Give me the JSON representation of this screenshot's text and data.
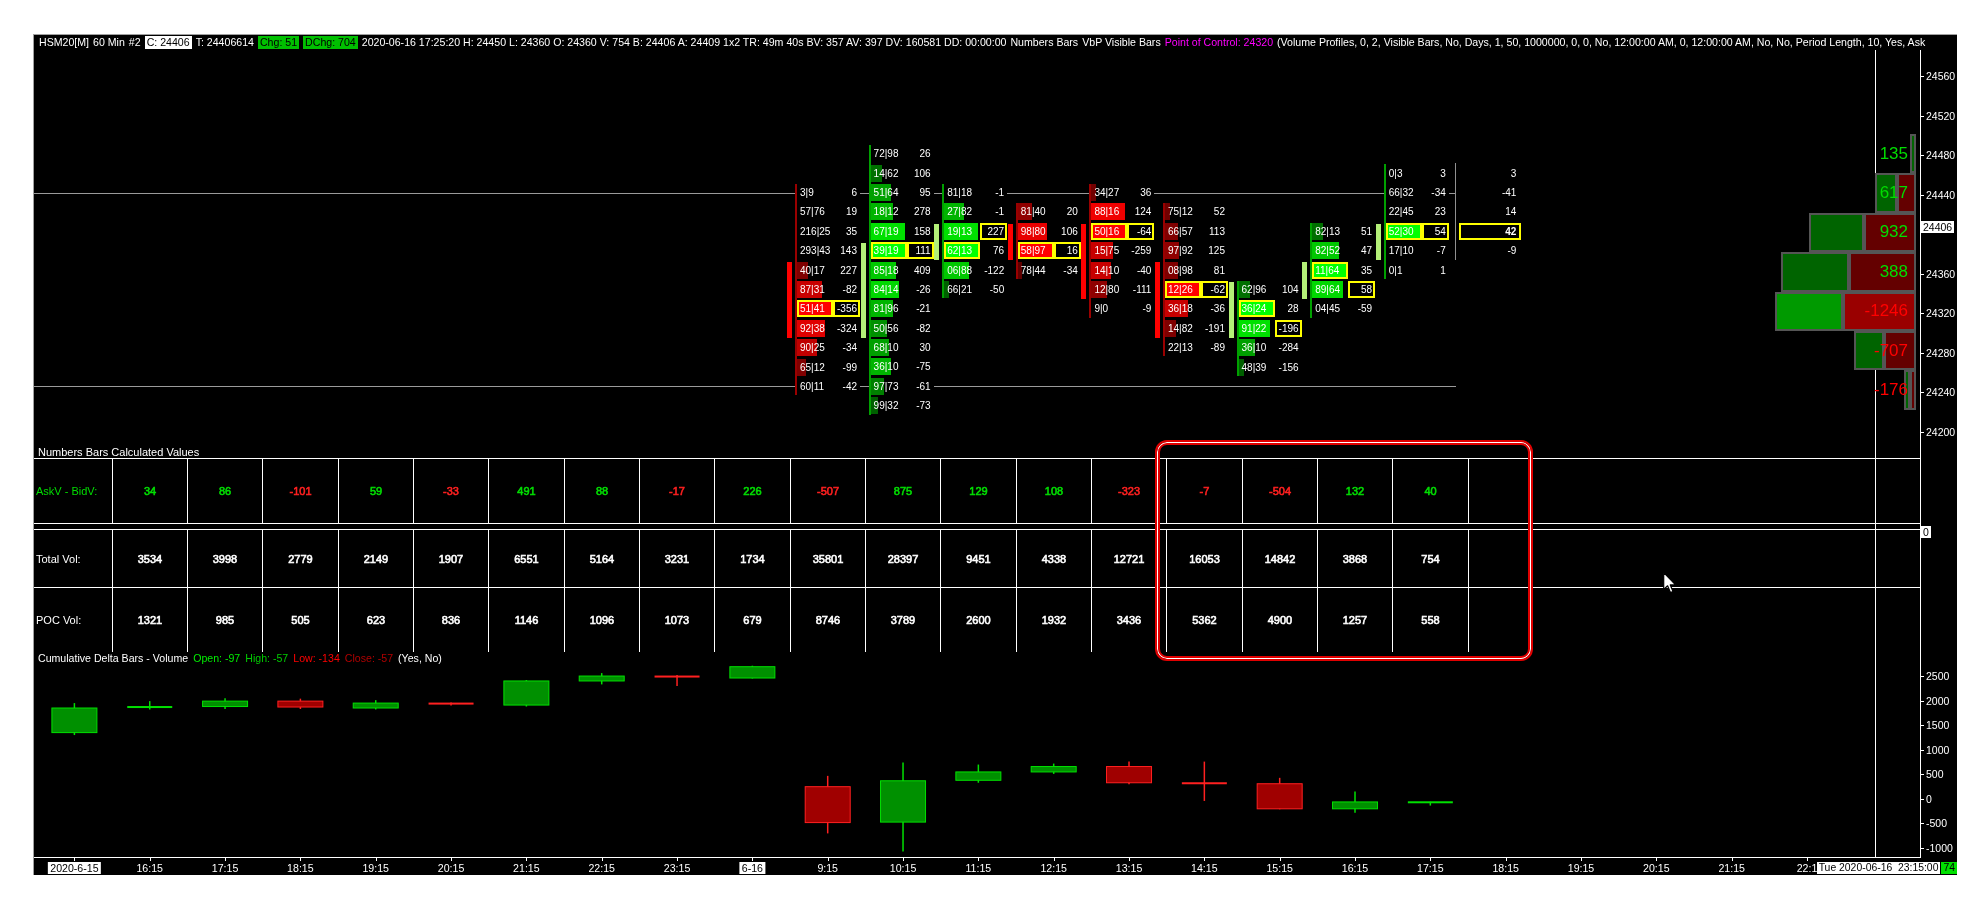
{
  "header": [
    {
      "text": "HSM20[M]",
      "kind": "plain"
    },
    {
      "text": "60 Min",
      "kind": "plain"
    },
    {
      "text": "#2",
      "kind": "plain"
    },
    {
      "text": "C: 24406",
      "kind": "inverse"
    },
    {
      "text": "T: 24406614",
      "kind": "plain"
    },
    {
      "text": "Chg: 51",
      "kind": "up"
    },
    {
      "text": "DChg: 704",
      "kind": "up"
    },
    {
      "text": "2020-06-16 17:25:20 H: 24450 L: 24360 O: 24360 V: 754 B: 24406 A: 24409 1x2 TR: 49m 40s BV: 357 AV: 397 DV: 160581 DD: 00:00:00",
      "kind": "plain"
    },
    {
      "text": "Numbers Bars",
      "kind": "plain"
    },
    {
      "text": "VbP Visible Bars",
      "kind": "plain"
    },
    {
      "text": "Point of Control: 24320",
      "kind": "highlight"
    },
    {
      "text": "(Volume Profiles, 0, 2, Visible Bars, No, Days, 1, 50, 1000000, 0, 0, No, 12:00:00 AM, 0, 12:00:00 AM, No, No, Period Length, 10, Yes, Ask",
      "kind": "plain"
    }
  ],
  "price_axis": [
    {
      "text": "24560",
      "kind": "tick"
    },
    {
      "text": "24520",
      "kind": "tick"
    },
    {
      "text": "24480",
      "kind": "tick"
    },
    {
      "text": "24440",
      "kind": "tick"
    },
    {
      "text": "24406",
      "kind": "last"
    },
    {
      "text": "24360",
      "kind": "tick"
    },
    {
      "text": "24320",
      "kind": "tick"
    },
    {
      "text": "24280",
      "kind": "tick"
    },
    {
      "text": "24240",
      "kind": "tick"
    },
    {
      "text": "24200",
      "kind": "tick"
    }
  ],
  "footprint": {
    "columns": [
      {
        "kind": "down",
        "cells": [
          {
            "bid_ask": "3|9",
            "delta": "6",
            "poc": false,
            "max_delta": false,
            "body": false
          },
          {
            "bid_ask": "57|76",
            "delta": "19",
            "poc": false,
            "max_delta": false,
            "body": false
          },
          {
            "bid_ask": "216|25",
            "delta": "35",
            "poc": false,
            "max_delta": false,
            "body": false
          },
          {
            "bid_ask": "293|43",
            "delta": "143",
            "poc": false,
            "max_delta": false,
            "body": false
          },
          {
            "bid_ask": "40|17",
            "delta": "227",
            "poc": false,
            "max_delta": false,
            "body": true
          },
          {
            "bid_ask": "87|31",
            "delta": "-82",
            "poc": false,
            "max_delta": false,
            "body": true
          },
          {
            "bid_ask": "51|41",
            "delta": "-356",
            "poc": true,
            "max_delta": true,
            "body": true
          },
          {
            "bid_ask": "92|38",
            "delta": "-324",
            "poc": false,
            "max_delta": false,
            "body": true
          },
          {
            "bid_ask": "90|25",
            "delta": "-34",
            "poc": false,
            "max_delta": false,
            "body": false
          },
          {
            "bid_ask": "65|12",
            "delta": "-99",
            "poc": false,
            "max_delta": false,
            "body": false
          },
          {
            "bid_ask": "60|11",
            "delta": "-42",
            "poc": false,
            "max_delta": false,
            "body": false
          }
        ]
      },
      {
        "kind": "up",
        "cells": [
          {
            "bid_ask": "72|98",
            "delta": "26",
            "poc": false,
            "max_delta": false,
            "body": false
          },
          {
            "bid_ask": "14|62",
            "delta": "106",
            "poc": false,
            "max_delta": false,
            "body": false
          },
          {
            "bid_ask": "51|64",
            "delta": "95",
            "poc": false,
            "max_delta": false,
            "body": false
          },
          {
            "bid_ask": "18|12",
            "delta": "278",
            "poc": false,
            "max_delta": false,
            "body": false
          },
          {
            "bid_ask": "67|19",
            "delta": "158",
            "poc": false,
            "max_delta": false,
            "body": false
          },
          {
            "bid_ask": "39|19",
            "delta": "111",
            "poc": true,
            "max_delta": true,
            "body": true
          },
          {
            "bid_ask": "85|18",
            "delta": "409",
            "poc": false,
            "max_delta": false,
            "body": true
          },
          {
            "bid_ask": "84|14",
            "delta": "-26",
            "poc": false,
            "max_delta": false,
            "body": true
          },
          {
            "bid_ask": "81|96",
            "delta": "-21",
            "poc": false,
            "max_delta": false,
            "body": true
          },
          {
            "bid_ask": "50|56",
            "delta": "-82",
            "poc": false,
            "max_delta": false,
            "body": true
          },
          {
            "bid_ask": "68|10",
            "delta": "30",
            "poc": false,
            "max_delta": false,
            "body": false
          },
          {
            "bid_ask": "36|10",
            "delta": "-75",
            "poc": false,
            "max_delta": false,
            "body": false
          },
          {
            "bid_ask": "97|73",
            "delta": "-61",
            "poc": false,
            "max_delta": false,
            "body": false
          },
          {
            "bid_ask": "99|32",
            "delta": "-73",
            "poc": false,
            "max_delta": false,
            "body": false
          }
        ]
      },
      {
        "kind": "up",
        "cells": [
          {
            "bid_ask": "81|18",
            "delta": "-1",
            "poc": false,
            "max_delta": false,
            "body": false
          },
          {
            "bid_ask": "27|82",
            "delta": "-1",
            "poc": false,
            "max_delta": false,
            "body": false
          },
          {
            "bid_ask": "19|13",
            "delta": "227",
            "poc": false,
            "max_delta": true,
            "body": true
          },
          {
            "bid_ask": "62|13",
            "delta": "76",
            "poc": true,
            "max_delta": false,
            "body": true
          },
          {
            "bid_ask": "06|88",
            "delta": "-122",
            "poc": false,
            "max_delta": false,
            "body": false
          },
          {
            "bid_ask": "66|21",
            "delta": "-50",
            "poc": false,
            "max_delta": false,
            "body": false
          }
        ]
      },
      {
        "kind": "down",
        "cells": [
          {
            "bid_ask": "81|40",
            "delta": "20",
            "poc": false,
            "max_delta": false,
            "body": false
          },
          {
            "bid_ask": "98|80",
            "delta": "106",
            "poc": false,
            "max_delta": false,
            "body": true
          },
          {
            "bid_ask": "58|97",
            "delta": "16",
            "poc": true,
            "max_delta": true,
            "body": true
          },
          {
            "bid_ask": "78|44",
            "delta": "-34",
            "poc": false,
            "max_delta": false,
            "body": false
          }
        ]
      },
      {
        "kind": "down",
        "cells": [
          {
            "bid_ask": "34|27",
            "delta": "36",
            "poc": false,
            "max_delta": false,
            "body": false
          },
          {
            "bid_ask": "88|16",
            "delta": "124",
            "poc": false,
            "max_delta": false,
            "body": false
          },
          {
            "bid_ask": "50|16",
            "delta": "-64",
            "poc": true,
            "max_delta": true,
            "body": true
          },
          {
            "bid_ask": "15|75",
            "delta": "-259",
            "poc": false,
            "max_delta": false,
            "body": true
          },
          {
            "bid_ask": "14|10",
            "delta": "-40",
            "poc": false,
            "max_delta": false,
            "body": true
          },
          {
            "bid_ask": "12|80",
            "delta": "-111",
            "poc": false,
            "max_delta": false,
            "body": true
          },
          {
            "bid_ask": "9|0",
            "delta": "-9",
            "poc": false,
            "max_delta": false,
            "body": false
          }
        ]
      },
      {
        "kind": "down",
        "cells": [
          {
            "bid_ask": "75|12",
            "delta": "52",
            "poc": false,
            "max_delta": false,
            "body": false
          },
          {
            "bid_ask": "66|57",
            "delta": "113",
            "poc": false,
            "max_delta": false,
            "body": false
          },
          {
            "bid_ask": "97|92",
            "delta": "125",
            "poc": false,
            "max_delta": false,
            "body": false
          },
          {
            "bid_ask": "08|98",
            "delta": "81",
            "poc": false,
            "max_delta": false,
            "body": true
          },
          {
            "bid_ask": "12|26",
            "delta": "-62",
            "poc": true,
            "max_delta": true,
            "body": true
          },
          {
            "bid_ask": "36|18",
            "delta": "-36",
            "poc": false,
            "max_delta": false,
            "body": true
          },
          {
            "bid_ask": "14|82",
            "delta": "-191",
            "poc": false,
            "max_delta": false,
            "body": true
          },
          {
            "bid_ask": "22|13",
            "delta": "-89",
            "poc": false,
            "max_delta": false,
            "body": false
          }
        ]
      },
      {
        "kind": "up",
        "cells": [
          {
            "bid_ask": "62|96",
            "delta": "104",
            "poc": false,
            "max_delta": false,
            "body": true
          },
          {
            "bid_ask": "36|24",
            "delta": "28",
            "poc": true,
            "max_delta": false,
            "body": true
          },
          {
            "bid_ask": "91|22",
            "delta": "-196",
            "poc": false,
            "max_delta": true,
            "body": true
          },
          {
            "bid_ask": "36|10",
            "delta": "-284",
            "poc": false,
            "max_delta": false,
            "body": false
          },
          {
            "bid_ask": "48|39",
            "delta": "-156",
            "poc": false,
            "max_delta": false,
            "body": false
          }
        ]
      },
      {
        "kind": "up",
        "cells": [
          {
            "bid_ask": "82|13",
            "delta": "51",
            "poc": false,
            "max_delta": false,
            "body": false
          },
          {
            "bid_ask": "82|52",
            "delta": "47",
            "poc": false,
            "max_delta": false,
            "body": false
          },
          {
            "bid_ask": "11|64",
            "delta": "35",
            "poc": true,
            "max_delta": false,
            "body": true
          },
          {
            "bid_ask": "89|64",
            "delta": "58",
            "poc": false,
            "max_delta": true,
            "body": true
          },
          {
            "bid_ask": "04|45",
            "delta": "-59",
            "poc": false,
            "max_delta": false,
            "body": false
          }
        ]
      },
      {
        "kind": "up",
        "cells": [
          {
            "bid_ask": "0|3",
            "delta": "3",
            "poc": false,
            "max_delta": false,
            "body": false
          },
          {
            "bid_ask": "66|32",
            "delta": "-34",
            "poc": false,
            "max_delta": false,
            "body": false
          },
          {
            "bid_ask": "22|45",
            "delta": "23",
            "poc": false,
            "max_delta": false,
            "body": false
          },
          {
            "bid_ask": "52|30",
            "delta": "54",
            "poc": true,
            "max_delta": true,
            "body": true
          },
          {
            "bid_ask": "17|10",
            "delta": "-7",
            "poc": false,
            "max_delta": false,
            "body": true
          },
          {
            "bid_ask": "0|1",
            "delta": "1",
            "poc": false,
            "max_delta": false,
            "body": false
          }
        ]
      }
    ],
    "totals": [
      {
        "delta": "3",
        "max_delta": false
      },
      {
        "delta": "-41",
        "max_delta": false
      },
      {
        "delta": "14",
        "max_delta": false
      },
      {
        "delta": "42",
        "max_delta": true
      },
      {
        "delta": "-9",
        "max_delta": false
      }
    ]
  },
  "volume_profile": [
    {
      "label": "135",
      "color": "#00dd00"
    },
    {
      "label": "617",
      "color": "#00dd00"
    },
    {
      "label": "932",
      "color": "#00dd00"
    },
    {
      "label": "388",
      "color": "#00dd00"
    },
    {
      "label": "-1246",
      "color": "#ff0000"
    },
    {
      "label": "-707",
      "color": "#ff0000"
    },
    {
      "label": "-176",
      "color": "#ff0000"
    }
  ],
  "calculated_values": {
    "title": "Numbers Bars Calculated Values",
    "axis_label": "0",
    "rows": [
      {
        "label": "AskV - BidV:",
        "color": "#00dd00",
        "cells": [
          {
            "text": "34",
            "color": "#00dd00"
          },
          {
            "text": "86",
            "color": "#00dd00"
          },
          {
            "text": "-101",
            "color": "#ff2020"
          },
          {
            "text": "59",
            "color": "#00dd00"
          },
          {
            "text": "-33",
            "color": "#ff2020"
          },
          {
            "text": "491",
            "color": "#00dd00"
          },
          {
            "text": "88",
            "color": "#00dd00"
          },
          {
            "text": "-17",
            "color": "#ff2020"
          },
          {
            "text": "226",
            "color": "#00dd00"
          },
          {
            "text": "-507",
            "color": "#ff2020"
          },
          {
            "text": "875",
            "color": "#00dd00"
          },
          {
            "text": "129",
            "color": "#00dd00"
          },
          {
            "text": "108",
            "color": "#00dd00"
          },
          {
            "text": "-323",
            "color": "#ff2020"
          },
          {
            "text": "-7",
            "color": "#ff2020"
          },
          {
            "text": "-504",
            "color": "#ff2020"
          },
          {
            "text": "132",
            "color": "#00dd00"
          },
          {
            "text": "40",
            "color": "#00dd00"
          }
        ]
      },
      {
        "label": "Total Vol:",
        "color": "#ffffff",
        "cells": [
          {
            "text": "3534"
          },
          {
            "text": "3998"
          },
          {
            "text": "2779"
          },
          {
            "text": "2149"
          },
          {
            "text": "1907"
          },
          {
            "text": "6551"
          },
          {
            "text": "5164"
          },
          {
            "text": "3231"
          },
          {
            "text": "1734"
          },
          {
            "text": "35801"
          },
          {
            "text": "28397"
          },
          {
            "text": "9451"
          },
          {
            "text": "4338"
          },
          {
            "text": "12721"
          },
          {
            "text": "16053"
          },
          {
            "text": "14842"
          },
          {
            "text": "3868"
          },
          {
            "text": "754"
          }
        ]
      },
      {
        "label": "POC Vol:",
        "color": "#ffffff",
        "cells": [
          {
            "text": "1321"
          },
          {
            "text": "985"
          },
          {
            "text": "505"
          },
          {
            "text": "623"
          },
          {
            "text": "836"
          },
          {
            "text": "1146"
          },
          {
            "text": "1096"
          },
          {
            "text": "1073"
          },
          {
            "text": "679"
          },
          {
            "text": "8746"
          },
          {
            "text": "3789"
          },
          {
            "text": "2600"
          },
          {
            "text": "1932"
          },
          {
            "text": "3436"
          },
          {
            "text": "5362"
          },
          {
            "text": "4900"
          },
          {
            "text": "1257"
          },
          {
            "text": "558"
          }
        ]
      }
    ]
  },
  "cumulative_delta": {
    "title": "Cumulative Delta Bars - Volume",
    "legend": [
      {
        "text": "Open: -97",
        "color": "#00ee00"
      },
      {
        "text": "High: -57",
        "color": "#00cc00"
      },
      {
        "text": "Low: -134",
        "color": "#ff0000"
      },
      {
        "text": "Close: -57",
        "color": "#b00000"
      }
    ],
    "note": "(Yes, No)",
    "y_axis": [
      "2500",
      "2000",
      "1500",
      "1000",
      "500",
      "0",
      "-500",
      "-1000"
    ]
  },
  "x_axis": {
    "labels": [
      {
        "text": "2020-6-15",
        "kind": "date"
      },
      {
        "text": "16:15",
        "kind": "time"
      },
      {
        "text": "17:15",
        "kind": "time"
      },
      {
        "text": "18:15",
        "kind": "time"
      },
      {
        "text": "19:15",
        "kind": "time"
      },
      {
        "text": "20:15",
        "kind": "time"
      },
      {
        "text": "21:15",
        "kind": "time"
      },
      {
        "text": "22:15",
        "kind": "time"
      },
      {
        "text": "23:15",
        "kind": "time"
      },
      {
        "text": "6-16",
        "kind": "date"
      },
      {
        "text": "9:15",
        "kind": "time"
      },
      {
        "text": "10:15",
        "kind": "time"
      },
      {
        "text": "11:15",
        "kind": "time"
      },
      {
        "text": "12:15",
        "kind": "time"
      },
      {
        "text": "13:15",
        "kind": "time"
      },
      {
        "text": "14:15",
        "kind": "time"
      },
      {
        "text": "15:15",
        "kind": "time"
      },
      {
        "text": "16:15",
        "kind": "time"
      },
      {
        "text": "17:15",
        "kind": "time"
      },
      {
        "text": "18:15",
        "kind": "time"
      },
      {
        "text": "19:15",
        "kind": "time"
      },
      {
        "text": "20:15",
        "kind": "time"
      },
      {
        "text": "21:15",
        "kind": "time"
      },
      {
        "text": "22:1",
        "kind": "time"
      }
    ]
  },
  "crosshair": {
    "time": "Tue 2020-06-16  23:15:00",
    "value": "74"
  }
}
